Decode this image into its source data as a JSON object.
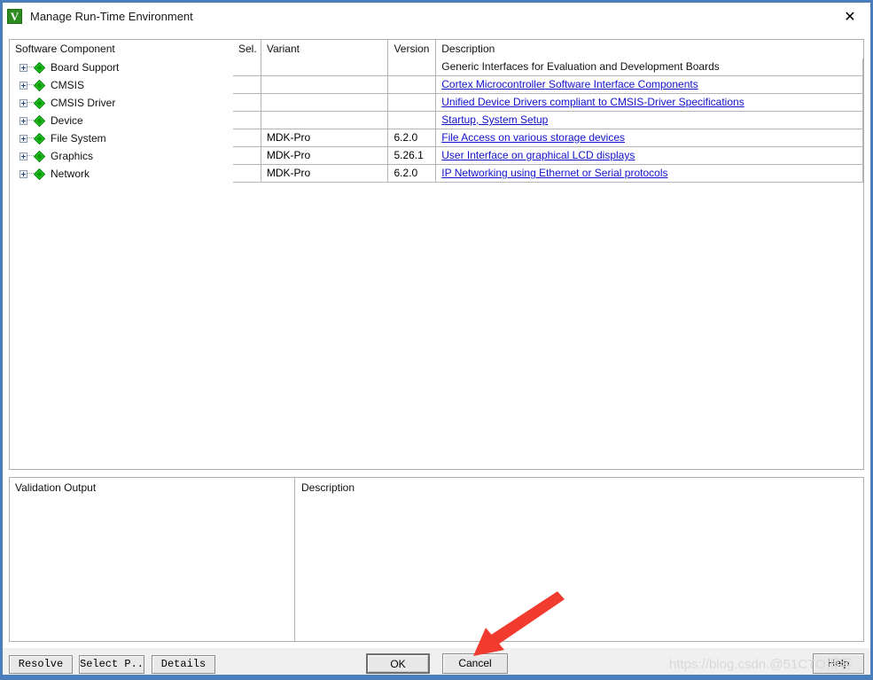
{
  "window": {
    "title": "Manage Run-Time Environment",
    "app_icon": "keil-uvision-icon",
    "close_label": "✕",
    "accent_color": "#4a7ebb"
  },
  "tree": {
    "header": "Software Component",
    "items": [
      {
        "label": "Board Support",
        "icon": "green-diamond-icon",
        "expanded": false
      },
      {
        "label": "CMSIS",
        "icon": "green-diamond-icon",
        "expanded": false
      },
      {
        "label": "CMSIS Driver",
        "icon": "green-diamond-icon",
        "expanded": false
      },
      {
        "label": "Device",
        "icon": "green-diamond-icon",
        "expanded": false
      },
      {
        "label": "File System",
        "icon": "green-diamond-icon",
        "expanded": false
      },
      {
        "label": "Graphics",
        "icon": "green-diamond-icon",
        "expanded": false
      },
      {
        "label": "Network",
        "icon": "green-diamond-icon",
        "expanded": false
      }
    ]
  },
  "grid": {
    "columns": [
      "Sel.",
      "Variant",
      "Version",
      "Description"
    ],
    "rows": [
      {
        "sel": "",
        "variant": "",
        "version": "",
        "description": "Generic Interfaces for Evaluation and Development Boards",
        "is_link": false
      },
      {
        "sel": "",
        "variant": "",
        "version": "",
        "description": "Cortex Microcontroller Software Interface Components",
        "is_link": true
      },
      {
        "sel": "",
        "variant": "",
        "version": "",
        "description": "Unified Device Drivers compliant to CMSIS-Driver Specifications",
        "is_link": true
      },
      {
        "sel": "",
        "variant": "",
        "version": "",
        "description": "Startup, System Setup",
        "is_link": true
      },
      {
        "sel": "",
        "variant": "MDK-Pro",
        "version": "6.2.0",
        "description": "File Access on various storage devices",
        "is_link": true
      },
      {
        "sel": "",
        "variant": "MDK-Pro",
        "version": "5.26.1",
        "description": "User Interface on graphical LCD displays",
        "is_link": true
      },
      {
        "sel": "",
        "variant": "MDK-Pro",
        "version": "6.2.0",
        "description": "IP Networking using Ethernet or Serial protocols",
        "is_link": true
      }
    ]
  },
  "lower": {
    "validation_output_title": "Validation Output",
    "description_title": "Description",
    "validation_output_content": "",
    "description_content": ""
  },
  "buttons": {
    "resolve": "Resolve",
    "select_packs": "Select P...",
    "details": "Details",
    "ok": "OK",
    "cancel": "Cancel",
    "help": "Help"
  },
  "annotation": {
    "arrow_color": "#f23b2f",
    "arrow_target": "cancel-button"
  },
  "watermark": {
    "text": "https://blog.csdn.@51CTO博客",
    "color": "#d9d9d9"
  }
}
